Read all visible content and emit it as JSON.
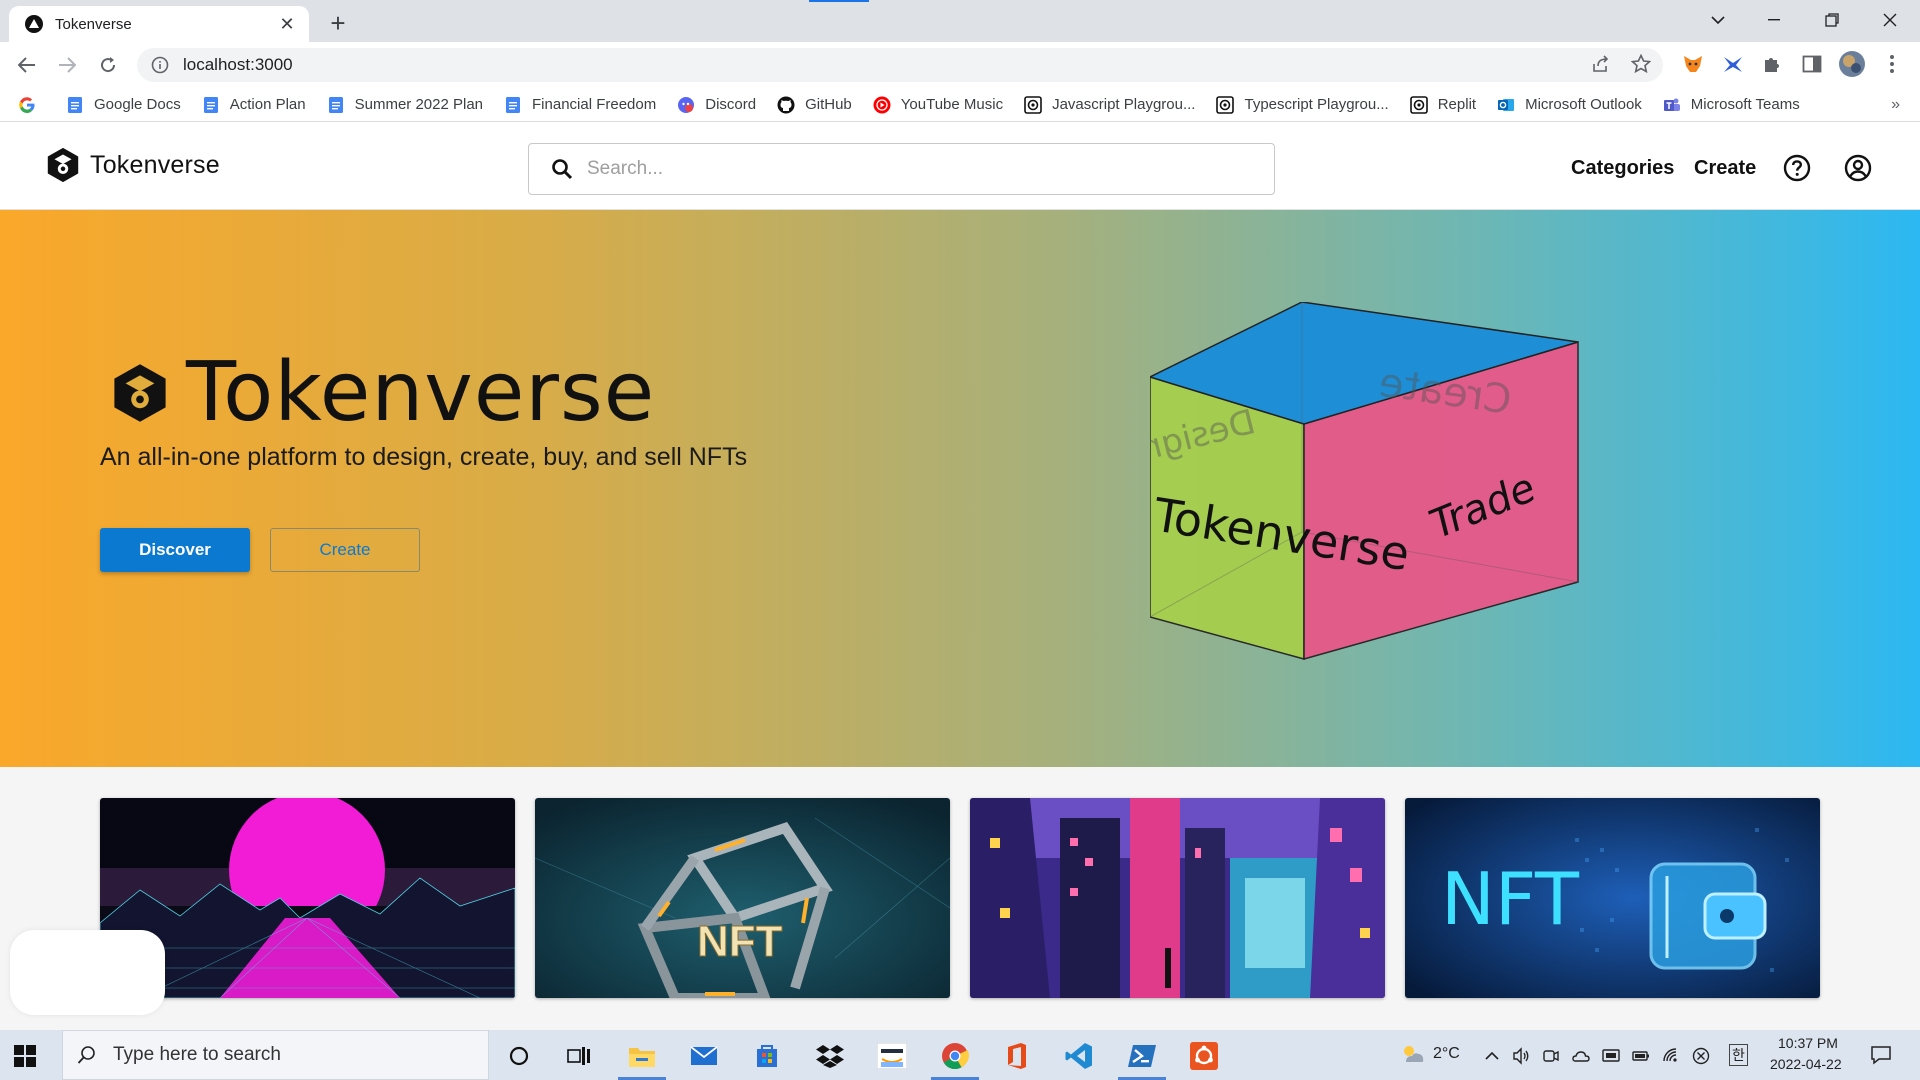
{
  "browser": {
    "tab_title": "Tokenverse",
    "tab_close": "✕",
    "new_tab": "+",
    "url": "localhost:3000",
    "accent": "#1a73e8"
  },
  "bookmarks": [
    {
      "label": "",
      "icon": "google-icon"
    },
    {
      "label": "Google Docs",
      "icon": "docs-icon"
    },
    {
      "label": "Action Plan",
      "icon": "docs-icon"
    },
    {
      "label": "Summer 2022 Plan",
      "icon": "docs-icon"
    },
    {
      "label": "Financial Freedom",
      "icon": "docs-icon"
    },
    {
      "label": "Discord",
      "icon": "discord-icon"
    },
    {
      "label": "GitHub",
      "icon": "github-icon"
    },
    {
      "label": "YouTube Music",
      "icon": "youtube-music-icon"
    },
    {
      "label": "Javascript Playgrou...",
      "icon": "playground-icon"
    },
    {
      "label": "Typescript Playgrou...",
      "icon": "playground-icon"
    },
    {
      "label": "Replit",
      "icon": "replit-icon"
    },
    {
      "label": "Microsoft Outlook",
      "icon": "outlook-icon"
    },
    {
      "label": "Microsoft Teams",
      "icon": "teams-icon"
    }
  ],
  "bookmarks_more": "»",
  "header": {
    "brand": "Tokenverse",
    "search_placeholder": "Search...",
    "categories": "Categories",
    "create": "Create"
  },
  "hero": {
    "title": "Tokenverse",
    "subtitle": "An all-in-one platform to design, create, buy, and sell NFTs",
    "discover_button": "Discover",
    "create_button": "Create",
    "cube_front_text": "Tokenverse",
    "cube_side_text": "Trade",
    "cube_back_left_text": "Design",
    "cube_back_right_text": "Create",
    "colors": {
      "primary": "#0b79d0",
      "cube_top": "#1e8fd6",
      "cube_front": "#a6cf4c",
      "cube_side": "#e85889"
    }
  },
  "cards": [
    {
      "name": "synthwave-sun-card",
      "caption": ""
    },
    {
      "name": "nft-cube-card",
      "caption": "NFT"
    },
    {
      "name": "neon-city-card",
      "caption": ""
    },
    {
      "name": "nft-wallet-card",
      "caption": "NFT"
    }
  ],
  "taskbar": {
    "search_placeholder": "Type here to search",
    "temperature": "2°C",
    "time": "10:37 PM",
    "date": "2022-04-22",
    "ime": "한"
  }
}
